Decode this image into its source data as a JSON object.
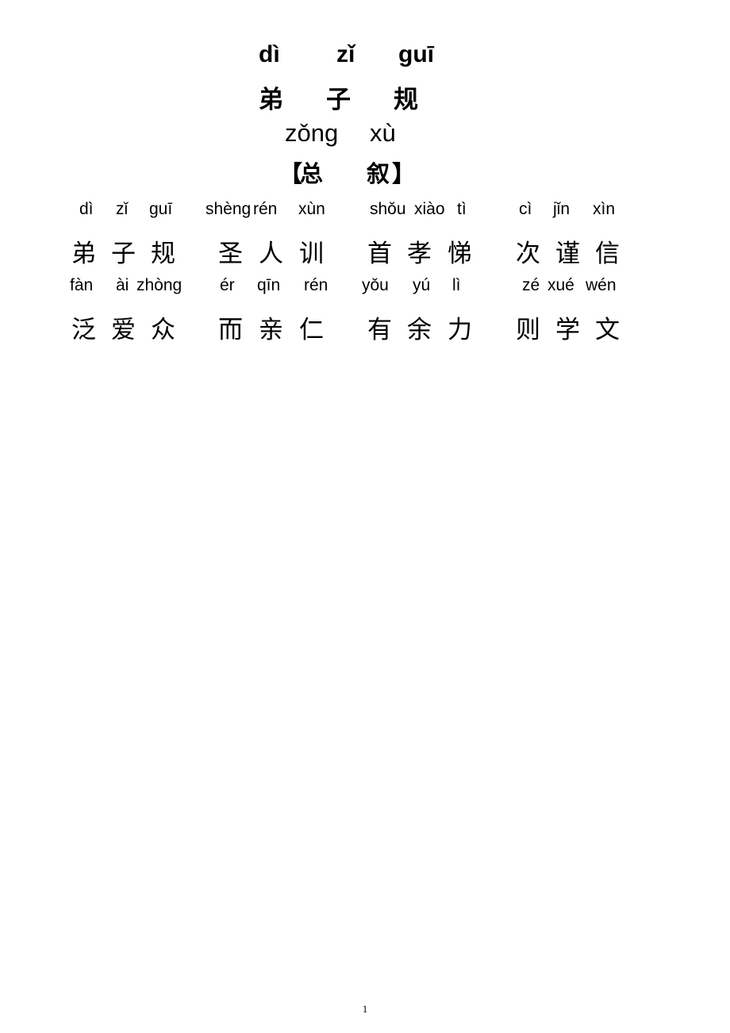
{
  "title": {
    "pinyin": [
      "dì",
      "zǐ",
      "guī"
    ],
    "chars": [
      "弟",
      "子",
      "规"
    ]
  },
  "section": {
    "pinyin": [
      "zǒng",
      "xù"
    ],
    "open_bracket": "【",
    "chars": [
      "总",
      "叙"
    ],
    "close_bracket": "】"
  },
  "lines": [
    {
      "groups": [
        {
          "pinyin": [
            "dì",
            "zǐ",
            "guī"
          ],
          "chars": [
            "弟",
            "子",
            "规"
          ]
        },
        {
          "pinyin": [
            "shèng",
            "rén",
            "xùn"
          ],
          "chars": [
            "圣",
            "人",
            "训"
          ]
        },
        {
          "pinyin": [
            "shǒu",
            "xiào",
            "tì"
          ],
          "chars": [
            "首",
            "孝",
            "悌"
          ]
        },
        {
          "pinyin": [
            "cì",
            "jǐn",
            "xìn"
          ],
          "chars": [
            "次",
            "谨",
            "信"
          ]
        }
      ]
    },
    {
      "groups": [
        {
          "pinyin": [
            "fàn",
            "ài",
            "zhòng"
          ],
          "chars": [
            "泛",
            "爱",
            "众"
          ]
        },
        {
          "pinyin": [
            "ér",
            "qīn",
            "rén"
          ],
          "chars": [
            "而",
            "亲",
            "仁"
          ]
        },
        {
          "pinyin": [
            "yǒu",
            "yú",
            "lì"
          ],
          "chars": [
            "有",
            "余",
            "力"
          ]
        },
        {
          "pinyin": [
            "zé",
            "xué",
            "wén"
          ],
          "chars": [
            "则",
            "学",
            "文"
          ]
        }
      ]
    }
  ],
  "page_number": "1"
}
